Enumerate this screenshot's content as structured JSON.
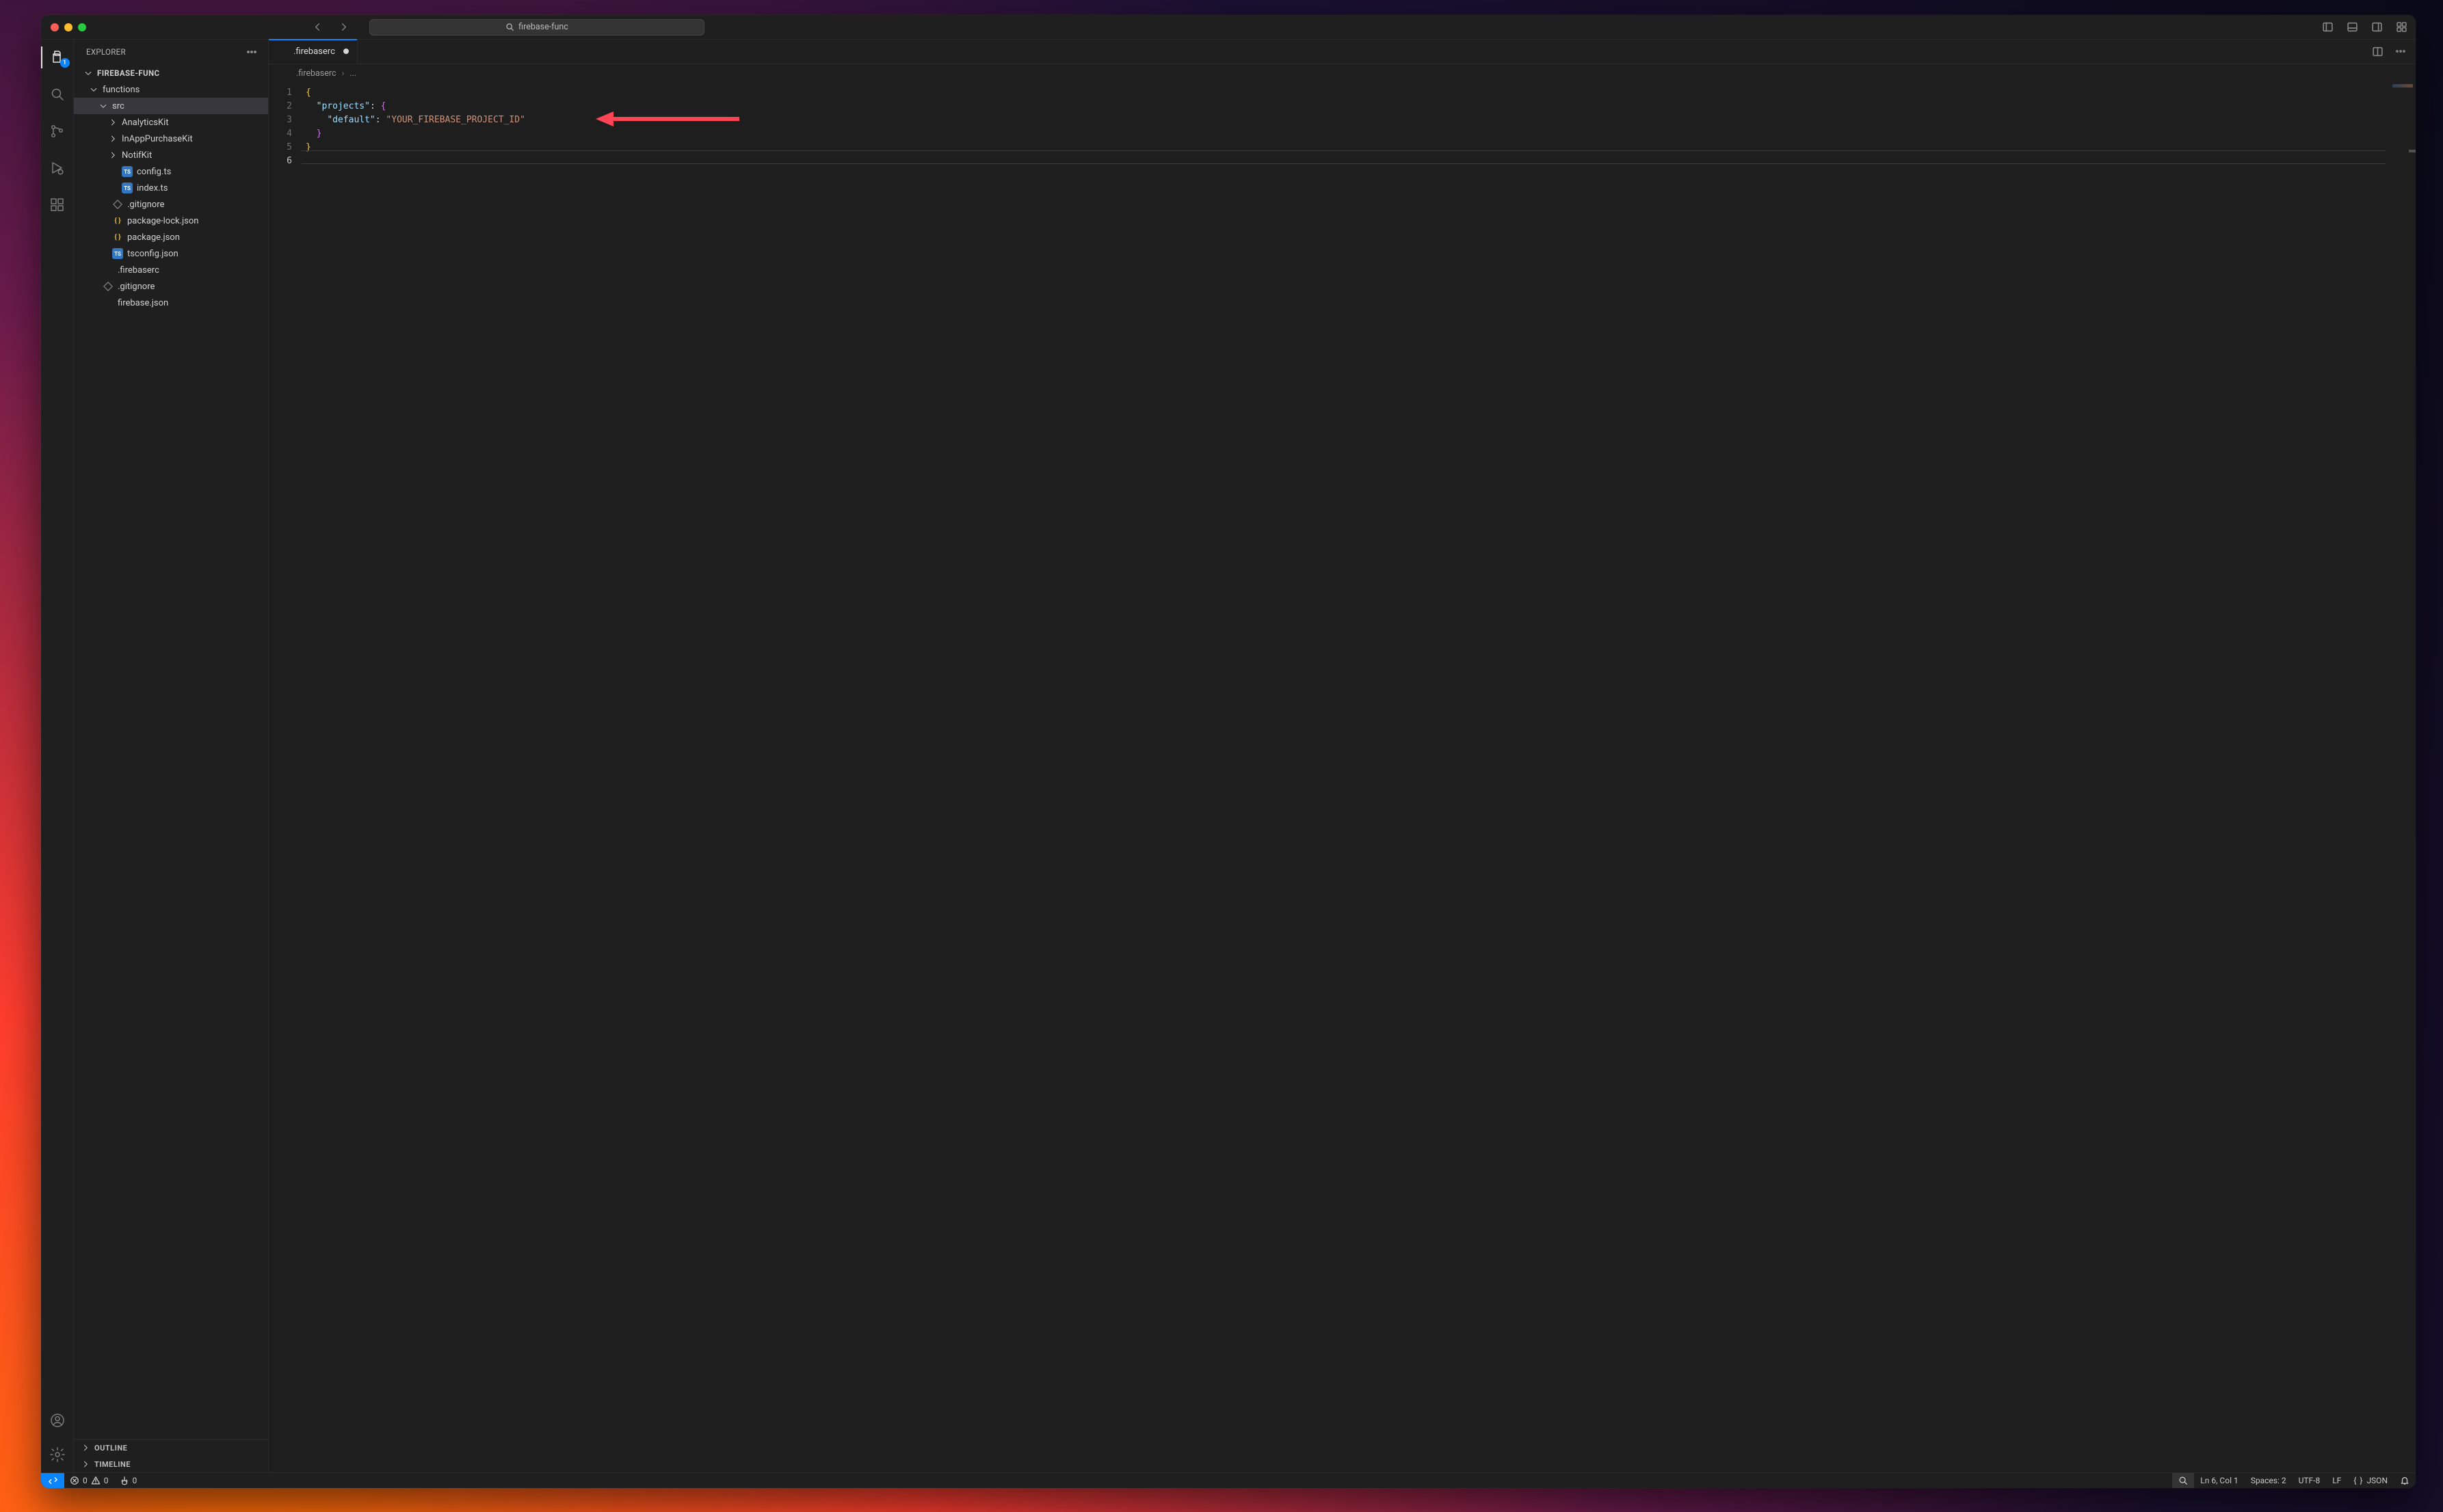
{
  "titlebar": {
    "search_placeholder": "firebase-func"
  },
  "activitybar": {
    "badge_count": "1"
  },
  "sidebar": {
    "title": "EXPLORER",
    "project": "FIREBASE-FUNC",
    "tree": {
      "functions": "functions",
      "src": "src",
      "analyticskit": "AnalyticsKit",
      "inapppurchasekit": "InAppPurchaseKit",
      "notifkit": "NotifKit",
      "config_ts": "config.ts",
      "index_ts": "index.ts",
      "func_gitignore": ".gitignore",
      "package_lock": "package-lock.json",
      "package_json": "package.json",
      "tsconfig": "tsconfig.json",
      "firebaserc": ".firebaserc",
      "root_gitignore": ".gitignore",
      "firebase_json": "firebase.json"
    },
    "outline": "OUTLINE",
    "timeline": "TIMELINE"
  },
  "tabs": {
    "firebaserc": {
      "label": ".firebaserc"
    }
  },
  "breadcrumbs": {
    "file": ".firebaserc",
    "tail": "..."
  },
  "editor": {
    "line_numbers": [
      "1",
      "2",
      "3",
      "4",
      "5",
      "6"
    ],
    "content": {
      "l2_key": "\"projects\"",
      "l3_key": "\"default\"",
      "l3_val": "\"YOUR_FIREBASE_PROJECT_ID\""
    }
  },
  "statusbar": {
    "errors": "0",
    "warnings": "0",
    "ports": "0",
    "ln_col": "Ln 6, Col 1",
    "spaces": "Spaces: 2",
    "encoding": "UTF-8",
    "eol": "LF",
    "lang_icon": "{ }",
    "language": "JSON"
  }
}
